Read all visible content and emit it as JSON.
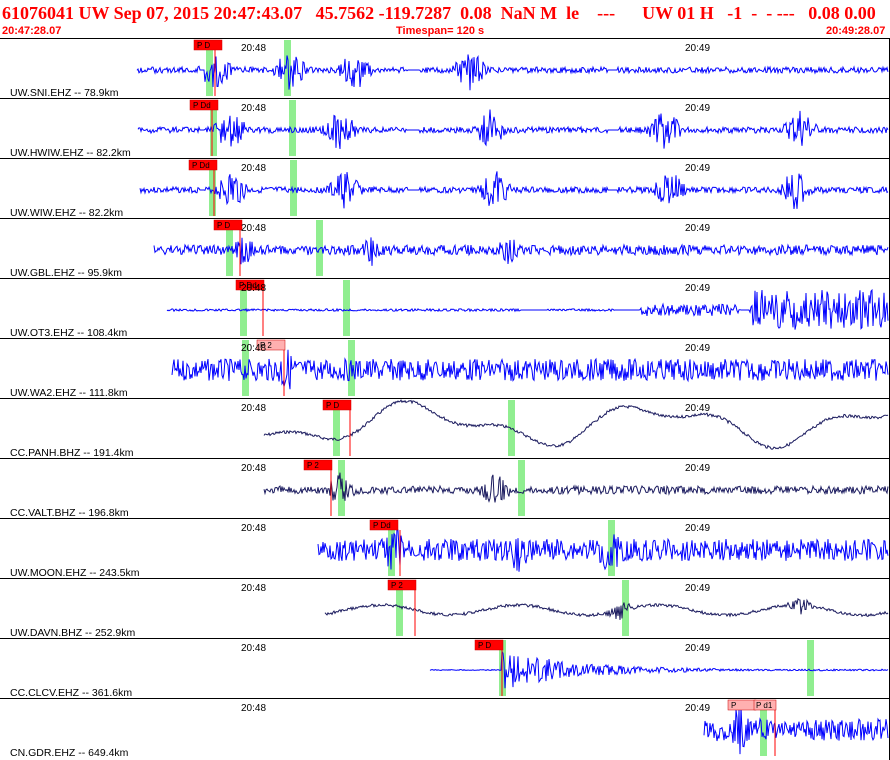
{
  "header": {
    "event_line": "61076041 UW Sep 07, 2015 20:47:43.07   45.7562 -119.7287  0.08  NaN M  le    ---      UW 01 H   -1  -  - ---   0.08 0.00",
    "start_time": "20:47:28.07",
    "timespan": "Timespan= 120 s",
    "end_time": "20:49:28.07"
  },
  "time_ticks": [
    "20:48",
    "20:49"
  ],
  "colors": {
    "header_text": "#ff0000",
    "trace_short_period": "#0000ff",
    "trace_broadband": "#1a1a5e",
    "pick_flag": "#ff0000",
    "pick_flag_light": "#ffb0b0",
    "pick_line": "#ff0000",
    "phase_window": "#90ee90",
    "separator": "#000000"
  },
  "channels": [
    {
      "label": "UW.SNI.EHZ -- 78.9km",
      "pick": "P D",
      "style": "flag-red",
      "trace": "trace_short_period"
    },
    {
      "label": "UW.HWIW.EHZ -- 82.2km",
      "pick": "P Dd",
      "style": "flag-red",
      "trace": "trace_short_period"
    },
    {
      "label": "UW.WIW.EHZ -- 82.2km",
      "pick": "P Dd",
      "style": "flag-red",
      "trace": "trace_short_period"
    },
    {
      "label": "UW.GBL.EHZ -- 95.9km",
      "pick": "P D",
      "style": "flag-red",
      "trace": "trace_short_period"
    },
    {
      "label": "UW.OT3.EHZ -- 108.4km",
      "pick": "P Dd",
      "style": "flag-red",
      "trace": "trace_short_period"
    },
    {
      "label": "UW.WA2.EHZ -- 111.8km",
      "pick": "P 2",
      "style": "flag-light",
      "trace": "trace_short_period"
    },
    {
      "label": "CC.PANH.BHZ -- 191.4km",
      "pick": "P D",
      "style": "flag-red",
      "trace": "trace_broadband"
    },
    {
      "label": "CC.VALT.BHZ -- 196.8km",
      "pick": "P 2",
      "style": "flag-red",
      "trace": "trace_broadband"
    },
    {
      "label": "UW.MOON.EHZ -- 243.5km",
      "pick": "P Dd",
      "style": "flag-red",
      "trace": "trace_short_period"
    },
    {
      "label": "UW.DAVN.BHZ -- 252.9km",
      "pick": "P 2",
      "style": "flag-red",
      "trace": "trace_broadband"
    },
    {
      "label": "CC.CLCV.EHZ -- 361.6km",
      "pick": "P D",
      "style": "flag-red",
      "trace": "trace_short_period"
    },
    {
      "label": "CN.GDR.EHZ -- 649.4km",
      "pick": "P",
      "pick2": "P d1",
      "style": "flag-light",
      "trace": "trace_short_period"
    }
  ]
}
